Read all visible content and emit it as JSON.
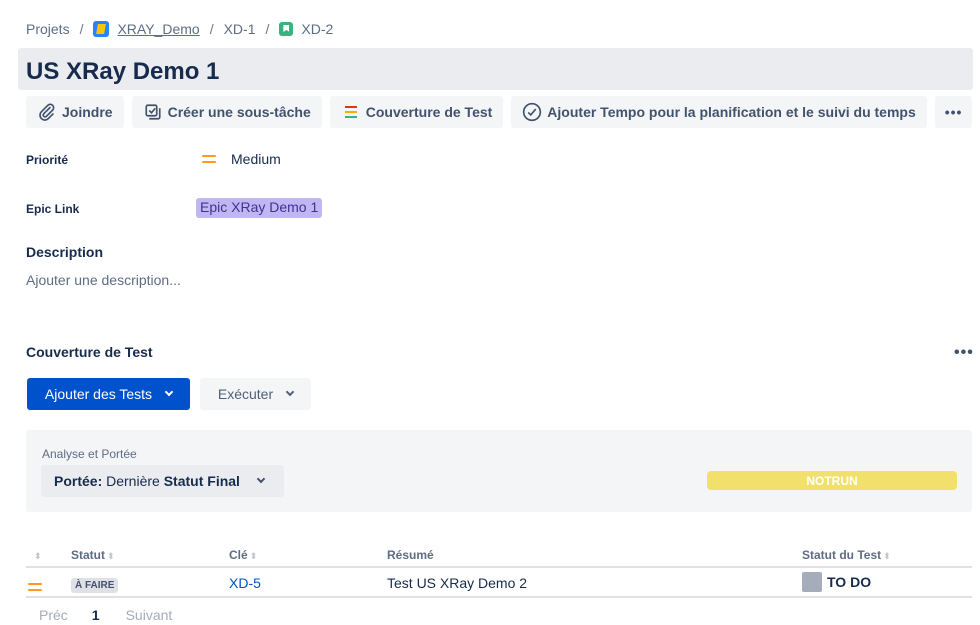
{
  "breadcrumb": {
    "root": "Projets",
    "project": "XRAY_Demo",
    "epic": "XD-1",
    "issue": "XD-2"
  },
  "issue": {
    "title": "US XRay Demo 1"
  },
  "toolbar": {
    "attach": "Joindre",
    "subtask": "Créer une sous-tâche",
    "coverage": "Couverture de Test",
    "tempo": "Ajouter Tempo pour la planification et le suivi du temps",
    "more": "•••"
  },
  "fields": {
    "priority_label": "Priorité",
    "priority_value": "Medium",
    "epic_label": "Epic Link",
    "epic_value": "Epic XRay Demo 1"
  },
  "description": {
    "title": "Description",
    "placeholder": "Ajouter une description..."
  },
  "coverage": {
    "title": "Couverture de Test",
    "more": "•••",
    "add_tests": "Ajouter des Tests",
    "execute": "Exécuter",
    "analysis_label": "Analyse et Portée",
    "scope_prefix": "Portée:",
    "scope_middle": "Dernière",
    "scope_value": "Statut Final",
    "status_bar_label": "NOTRUN"
  },
  "table": {
    "columns": [
      "Statut",
      "Clé",
      "Résumé",
      "Statut du Test"
    ],
    "rows": [
      {
        "status": "À FAIRE",
        "key": "XD-5",
        "summary": "Test US XRay Demo 2",
        "test_status": "TO DO"
      }
    ]
  },
  "pagination": {
    "prev": "Préc",
    "current": "1",
    "next": "Suivant"
  },
  "colors": {
    "primary": "#0052cc",
    "epic_bg": "#c0b6f2",
    "notrun": "#f1e06b",
    "priority_medium": "#ff991f",
    "todo_swatch": "#a5adba"
  }
}
